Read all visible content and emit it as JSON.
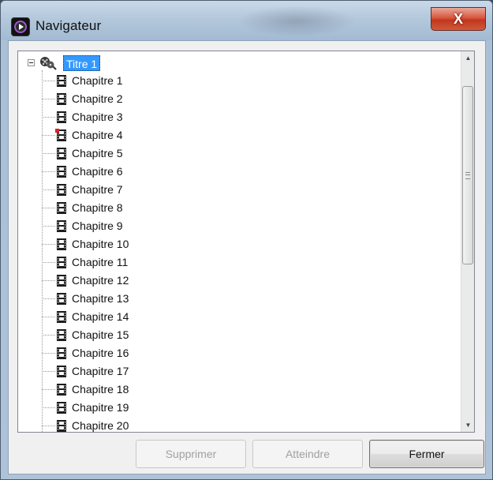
{
  "window": {
    "title": "Navigateur",
    "close_label": "X"
  },
  "tree": {
    "root": {
      "label": "Titre 1",
      "expanded": true,
      "selected": true,
      "icon": "film-reel-icon"
    },
    "children": [
      {
        "label": "Chapitre 1",
        "icon": "film-strip-icon",
        "marked": false
      },
      {
        "label": "Chapitre 2",
        "icon": "film-strip-icon",
        "marked": false
      },
      {
        "label": "Chapitre 3",
        "icon": "film-strip-icon",
        "marked": false
      },
      {
        "label": "Chapitre 4",
        "icon": "film-strip-icon",
        "marked": true
      },
      {
        "label": "Chapitre 5",
        "icon": "film-strip-icon",
        "marked": false
      },
      {
        "label": "Chapitre 6",
        "icon": "film-strip-icon",
        "marked": false
      },
      {
        "label": "Chapitre 7",
        "icon": "film-strip-icon",
        "marked": false
      },
      {
        "label": "Chapitre 8",
        "icon": "film-strip-icon",
        "marked": false
      },
      {
        "label": "Chapitre 9",
        "icon": "film-strip-icon",
        "marked": false
      },
      {
        "label": "Chapitre 10",
        "icon": "film-strip-icon",
        "marked": false
      },
      {
        "label": "Chapitre 11",
        "icon": "film-strip-icon",
        "marked": false
      },
      {
        "label": "Chapitre 12",
        "icon": "film-strip-icon",
        "marked": false
      },
      {
        "label": "Chapitre 13",
        "icon": "film-strip-icon",
        "marked": false
      },
      {
        "label": "Chapitre 14",
        "icon": "film-strip-icon",
        "marked": false
      },
      {
        "label": "Chapitre 15",
        "icon": "film-strip-icon",
        "marked": false
      },
      {
        "label": "Chapitre 16",
        "icon": "film-strip-icon",
        "marked": false
      },
      {
        "label": "Chapitre 17",
        "icon": "film-strip-icon",
        "marked": false
      },
      {
        "label": "Chapitre 18",
        "icon": "film-strip-icon",
        "marked": false
      },
      {
        "label": "Chapitre 19",
        "icon": "film-strip-icon",
        "marked": false
      },
      {
        "label": "Chapitre 20",
        "icon": "film-strip-icon",
        "marked": false
      }
    ],
    "marker_color": "#d9232d",
    "selection_color": "#3399ff"
  },
  "buttons": {
    "delete_label": "Supprimer",
    "goto_label": "Atteindre",
    "close_label": "Fermer"
  },
  "colors": {
    "close_button": "#c9452b"
  }
}
